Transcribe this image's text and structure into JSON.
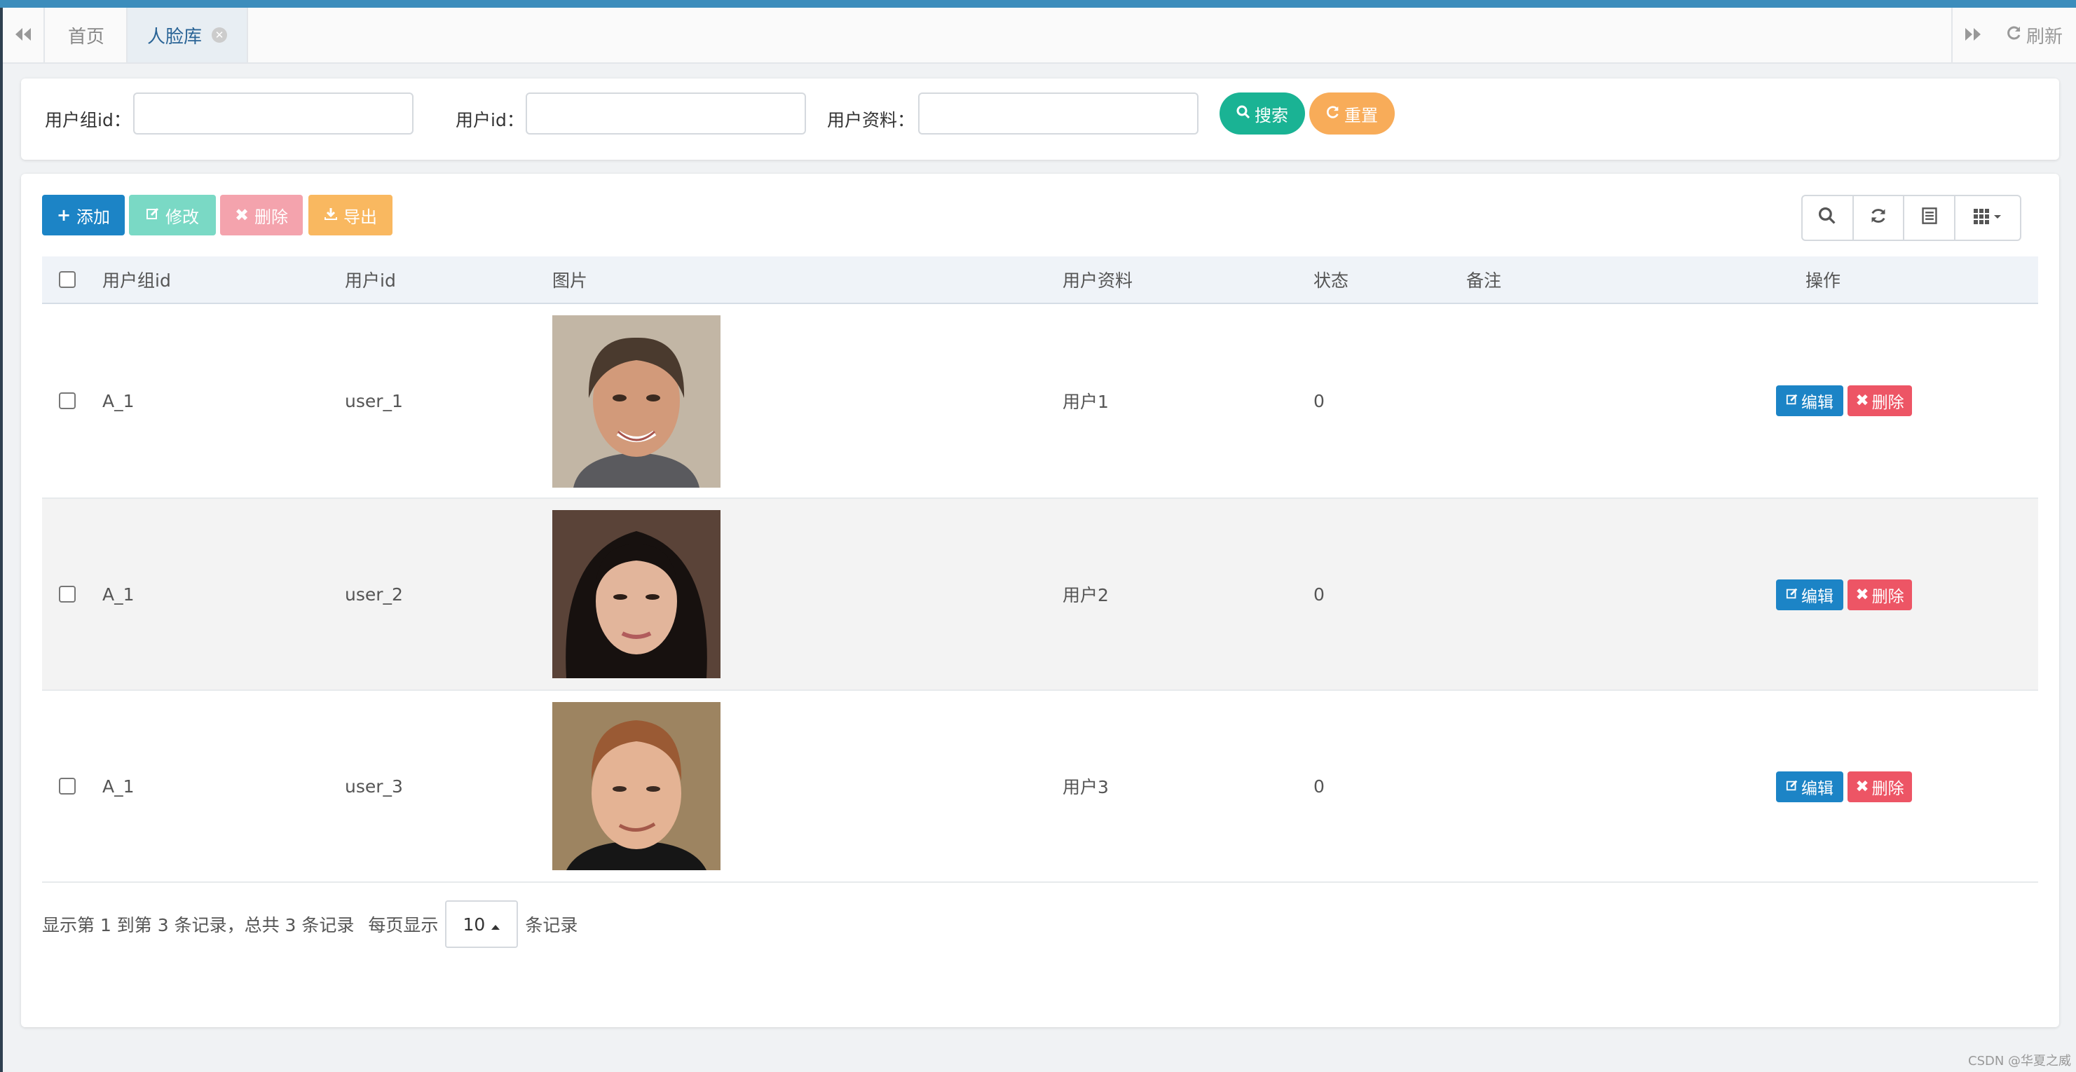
{
  "tabs": {
    "home": "首页",
    "active": "人脸库",
    "refresh": "刷新"
  },
  "search": {
    "group_label": "用户组id：",
    "user_label": "用户id：",
    "info_label": "用户资料：",
    "search_btn": "搜索",
    "reset_btn": "重置"
  },
  "toolbar": {
    "add": "添加",
    "edit": "修改",
    "delete": "删除",
    "export": "导出"
  },
  "table": {
    "headers": [
      "用户组id",
      "用户id",
      "图片",
      "用户资料",
      "状态",
      "备注",
      "操作"
    ],
    "rows": [
      {
        "group": "A_1",
        "user": "user_1",
        "info": "用户1",
        "status": "0",
        "note": ""
      },
      {
        "group": "A_1",
        "user": "user_2",
        "info": "用户2",
        "status": "0",
        "note": ""
      },
      {
        "group": "A_1",
        "user": "user_3",
        "info": "用户3",
        "status": "0",
        "note": ""
      }
    ],
    "row_edit": "编辑",
    "row_delete": "删除"
  },
  "pagination": {
    "summary": "显示第 1 到第 3 条记录，总共 3 条记录",
    "per_page_label": "每页显示",
    "per_page_value": "10",
    "records_suffix": "条记录"
  },
  "watermark": "CSDN @华夏之威",
  "colors": {
    "primary": "#1c84c6",
    "success": "#1ab394",
    "warning": "#f8ac59",
    "danger": "#ed5565"
  }
}
